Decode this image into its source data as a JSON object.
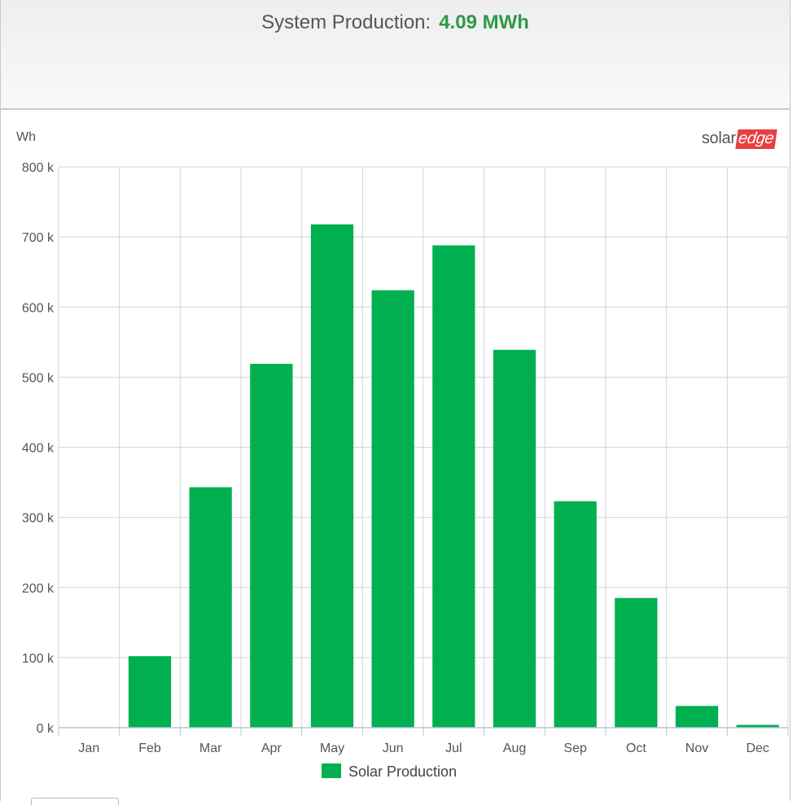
{
  "header": {
    "label": "System Production:",
    "value": "4.09 MWh"
  },
  "logo": {
    "part1": "solar",
    "part2": "edge"
  },
  "colors": {
    "bar": "#00b050",
    "value_text": "#2e9a47",
    "grid": "#d4d4d4",
    "logo_accent": "#e8403f"
  },
  "chart_data": {
    "type": "bar",
    "ylabel": "Wh",
    "categories": [
      "Jan",
      "Feb",
      "Mar",
      "Apr",
      "May",
      "Jun",
      "Jul",
      "Aug",
      "Sep",
      "Oct",
      "Nov",
      "Dec"
    ],
    "series": [
      {
        "name": "Solar Production",
        "color": "#00b050",
        "values": [
          0,
          102000,
          343000,
          519000,
          718000,
          624000,
          688000,
          539000,
          323000,
          185000,
          31000,
          4000
        ]
      }
    ],
    "ylim": [
      0,
      800000
    ],
    "yticks": [
      0,
      100000,
      200000,
      300000,
      400000,
      500000,
      600000,
      700000,
      800000
    ],
    "ytick_labels": [
      "0 k",
      "100 k",
      "200 k",
      "300 k",
      "400 k",
      "500 k",
      "600 k",
      "700 k",
      "800 k"
    ],
    "grid": true,
    "legend": "bottom-center"
  }
}
